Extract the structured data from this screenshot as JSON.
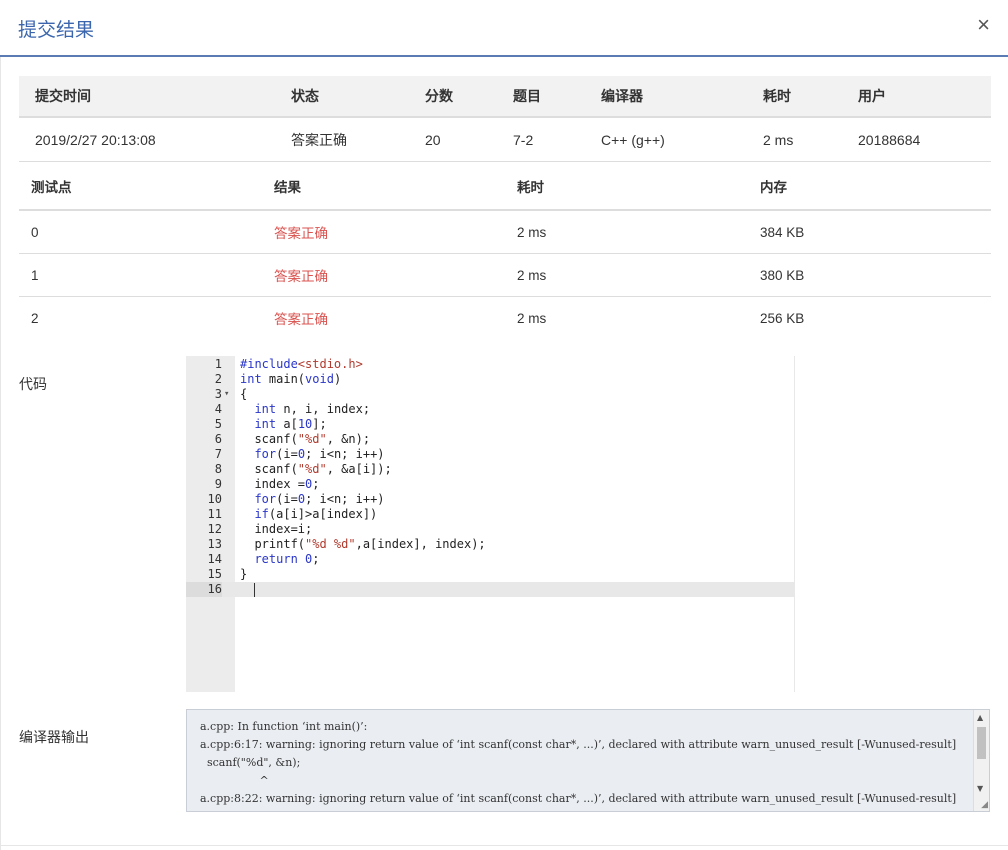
{
  "modal": {
    "title": "提交结果",
    "close": "×"
  },
  "submission": {
    "headers": [
      "提交时间",
      "状态",
      "分数",
      "题目",
      "编译器",
      "耗时",
      "用户"
    ],
    "row": {
      "time": "2019/2/27 20:13:08",
      "status": "答案正确",
      "score": "20",
      "problem": "7-2",
      "compiler": "C++ (g++)",
      "elapsed": "2 ms",
      "user": "20188684"
    }
  },
  "testcases": {
    "headers": [
      "测试点",
      "结果",
      "耗时",
      "内存"
    ],
    "rows": [
      {
        "id": "0",
        "result": "答案正确",
        "time": "2 ms",
        "memory": "384 KB"
      },
      {
        "id": "1",
        "result": "答案正确",
        "time": "2 ms",
        "memory": "380 KB"
      },
      {
        "id": "2",
        "result": "答案正确",
        "time": "2 ms",
        "memory": "256 KB"
      }
    ]
  },
  "code_section": {
    "label": "代码",
    "lines": [
      "#include<stdio.h>",
      "int main(void)",
      "{",
      "  int n, i, index;",
      "  int a[10];",
      "  scanf(\"%d\", &n);",
      "  for(i=0; i<n; i++)",
      "  scanf(\"%d\", &a[i]);",
      "  index =0;",
      "  for(i=0; i<n; i++)",
      "  if(a[i]>a[index])",
      "  index=i;",
      "  printf(\"%d %d\",a[index], index);",
      "  return 0;",
      "}",
      ""
    ]
  },
  "compiler_output": {
    "label": "编译器输出",
    "text": "a.cpp: In function ‘int main()’:\na.cpp:6:17: warning: ignoring return value of ‘int scanf(const char*, ...)’, declared with attribute warn_unused_result [-Wunused-result]\n  scanf(\"%d\", &n);\n                 ^\na.cpp:8:22: warning: ignoring return value of ‘int scanf(const char*, ...)’, declared with attribute warn_unused_result [-Wunused-result]"
  }
}
